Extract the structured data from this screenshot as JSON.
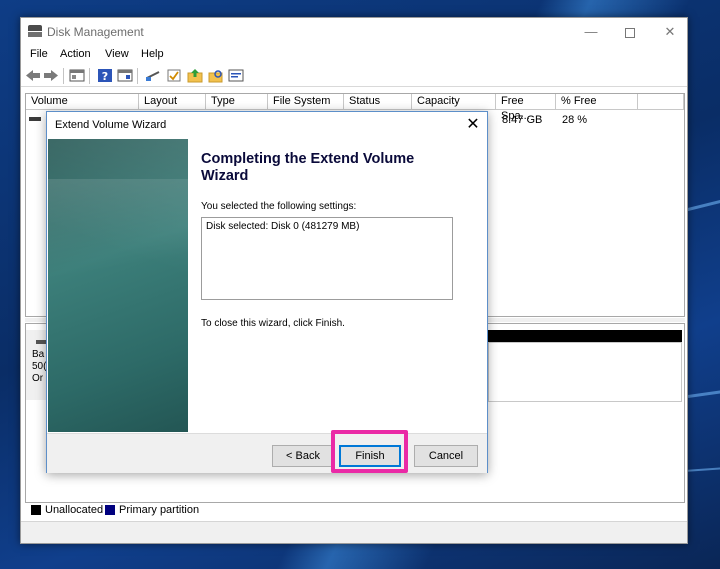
{
  "window": {
    "title": "Disk Management",
    "minimize_glyph": "—",
    "close_glyph": "✕"
  },
  "menu": [
    "File",
    "Action",
    "View",
    "Help"
  ],
  "toolbar_icons": [
    "back-arrow-icon",
    "forward-arrow-icon",
    "disk-list-icon",
    "help-icon",
    "properties-icon",
    "connect-icon",
    "check-icon",
    "up-folder-icon",
    "search-folder-icon",
    "settings-icon"
  ],
  "volume_list": {
    "columns": [
      "Volume",
      "Layout",
      "Type",
      "File System",
      "Status",
      "Capacity",
      "Free Spa...",
      "% Free"
    ],
    "row": {
      "free_space": "8.47 GB",
      "percent_free": "28 %"
    }
  },
  "disk_map": {
    "label_lines": [
      "Ba",
      "50(",
      "Or"
    ]
  },
  "legend": [
    {
      "label": "Unallocated",
      "color": "#000000"
    },
    {
      "label": "Primary partition",
      "color": "#00007f"
    }
  ],
  "wizard": {
    "title": "Extend Volume Wizard",
    "close_glyph": "✕",
    "heading": "Completing the Extend Volume Wizard",
    "prompt": "You selected the following settings:",
    "settings": "Disk selected: Disk 0 (481279 MB)",
    "close_instruction": "To close this wizard, click Finish.",
    "buttons": {
      "back": "< Back",
      "finish": "Finish",
      "cancel": "Cancel"
    }
  },
  "colors": {
    "highlight": "#ea2aa6",
    "accent": "#0078d7"
  }
}
